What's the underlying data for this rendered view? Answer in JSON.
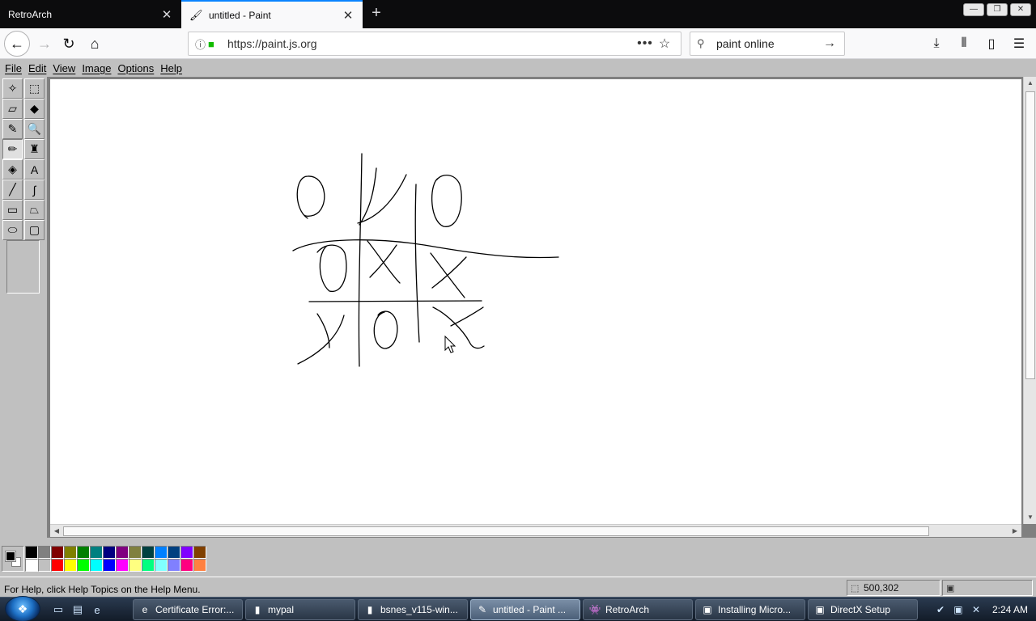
{
  "browser": {
    "tabs": [
      {
        "title": "RetroArch",
        "active": false
      },
      {
        "title": "untitled - Paint",
        "active": true
      }
    ],
    "url": "https://paint.js.org",
    "search_text": "paint online",
    "icons": {
      "back": "←",
      "forward": "→",
      "reload": "↻",
      "home": "⌂",
      "info": "ⓘ",
      "lock": "🔒",
      "page_actions": "•••",
      "star": "☆",
      "search": "🔍",
      "go": "→",
      "download": "⤓",
      "library": "⫴",
      "sidebar": "▯",
      "menu": "☰",
      "close": "✕",
      "new_tab": "+",
      "minimize": "—",
      "restore": "❐",
      "close_window": "✕"
    }
  },
  "paint": {
    "menu": [
      "File",
      "Edit",
      "View",
      "Image",
      "Options",
      "Help"
    ],
    "tools": [
      {
        "name": "free-form-select",
        "glyph": "✧"
      },
      {
        "name": "select",
        "glyph": "⬚"
      },
      {
        "name": "eraser",
        "glyph": "▱"
      },
      {
        "name": "fill",
        "glyph": "◆"
      },
      {
        "name": "pick-color",
        "glyph": "✎"
      },
      {
        "name": "magnifier",
        "glyph": "🔍"
      },
      {
        "name": "pencil",
        "glyph": "✏",
        "pressed": true
      },
      {
        "name": "brush",
        "glyph": "♜"
      },
      {
        "name": "airbrush",
        "glyph": "◈"
      },
      {
        "name": "text",
        "glyph": "A"
      },
      {
        "name": "line",
        "glyph": "╱"
      },
      {
        "name": "curve",
        "glyph": "∫"
      },
      {
        "name": "rectangle",
        "glyph": "▭"
      },
      {
        "name": "polygon",
        "glyph": "⏢"
      },
      {
        "name": "ellipse",
        "glyph": "⬭"
      },
      {
        "name": "rounded-rectangle",
        "glyph": "▢"
      }
    ],
    "palette": {
      "foreground": "#000000",
      "background": "#ffffff",
      "colors_top": [
        "#000000",
        "#808080",
        "#800000",
        "#808000",
        "#008000",
        "#008080",
        "#000080",
        "#800080",
        "#808040",
        "#004040",
        "#0080ff",
        "#004080",
        "#8000ff",
        "#804000"
      ],
      "colors_bottom": [
        "#ffffff",
        "#c0c0c0",
        "#ff0000",
        "#ffff00",
        "#00ff00",
        "#00ffff",
        "#0000ff",
        "#ff00ff",
        "#ffff80",
        "#00ff80",
        "#80ffff",
        "#8080ff",
        "#ff0080",
        "#ff8040"
      ]
    },
    "status_help": "For Help, click Help Topics on the Help Menu.",
    "cursor_position": "500,302"
  },
  "taskbar": {
    "tasks": [
      {
        "label": "Certificate Error:...",
        "icon": "e",
        "active": false
      },
      {
        "label": "mypal",
        "icon": "▮",
        "active": false
      },
      {
        "label": "bsnes_v115-win...",
        "icon": "▮",
        "active": false
      },
      {
        "label": "untitled - Paint ...",
        "icon": "✎",
        "active": true
      },
      {
        "label": "RetroArch",
        "icon": "👾",
        "active": false
      },
      {
        "label": "Installing Micro...",
        "icon": "▣",
        "active": false
      },
      {
        "label": "DirectX Setup",
        "icon": "▣",
        "active": false
      }
    ],
    "clock": "2:24 AM",
    "quicklaunch": [
      "▭",
      "▤",
      "e"
    ]
  }
}
